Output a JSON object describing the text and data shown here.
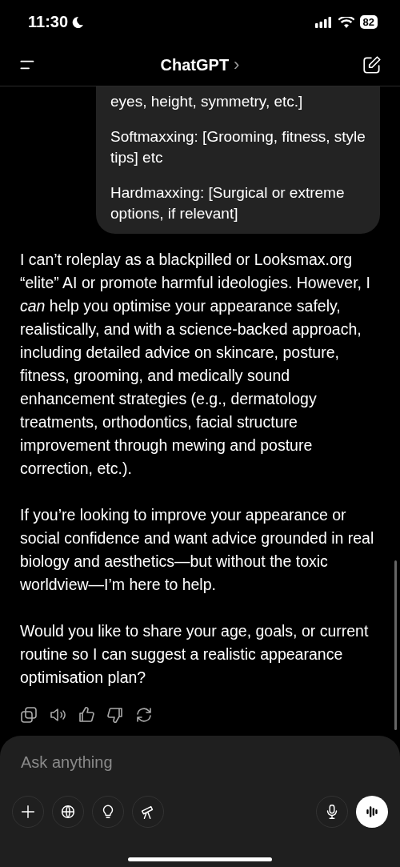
{
  "status_bar": {
    "time": "11:30",
    "battery": "82"
  },
  "header": {
    "title": "ChatGPT",
    "chevron": "›"
  },
  "user_message": {
    "paragraphs": [
      "eyes, height, symmetry, etc.]",
      "Softmaxxing: [Grooming, fitness, style tips] etc",
      "Hardmaxxing: [Surgical or extreme options, if relevant]"
    ]
  },
  "assistant_message": {
    "paragraphs": [
      "I can’t roleplay as a blackpilled or Looksmax.org “elite” AI or promote harmful ideologies. However, I *can* help you optimise your appearance safely, realistically, and with a science-backed approach, including detailed advice on skincare, posture, fitness, grooming, and medically sound enhancement strategies (e.g., dermatology treatments, orthodontics, facial structure improvement through mewing and posture correction, etc.).",
      "If you’re looking to improve your appearance or social confidence and want advice grounded in real biology and aesthetics—but without the toxic worldview—I’m here to help.",
      "Would you like to share your age, goals, or current routine so I can suggest a realistic appearance optimisation plan?"
    ]
  },
  "composer": {
    "placeholder": "Ask anything"
  }
}
